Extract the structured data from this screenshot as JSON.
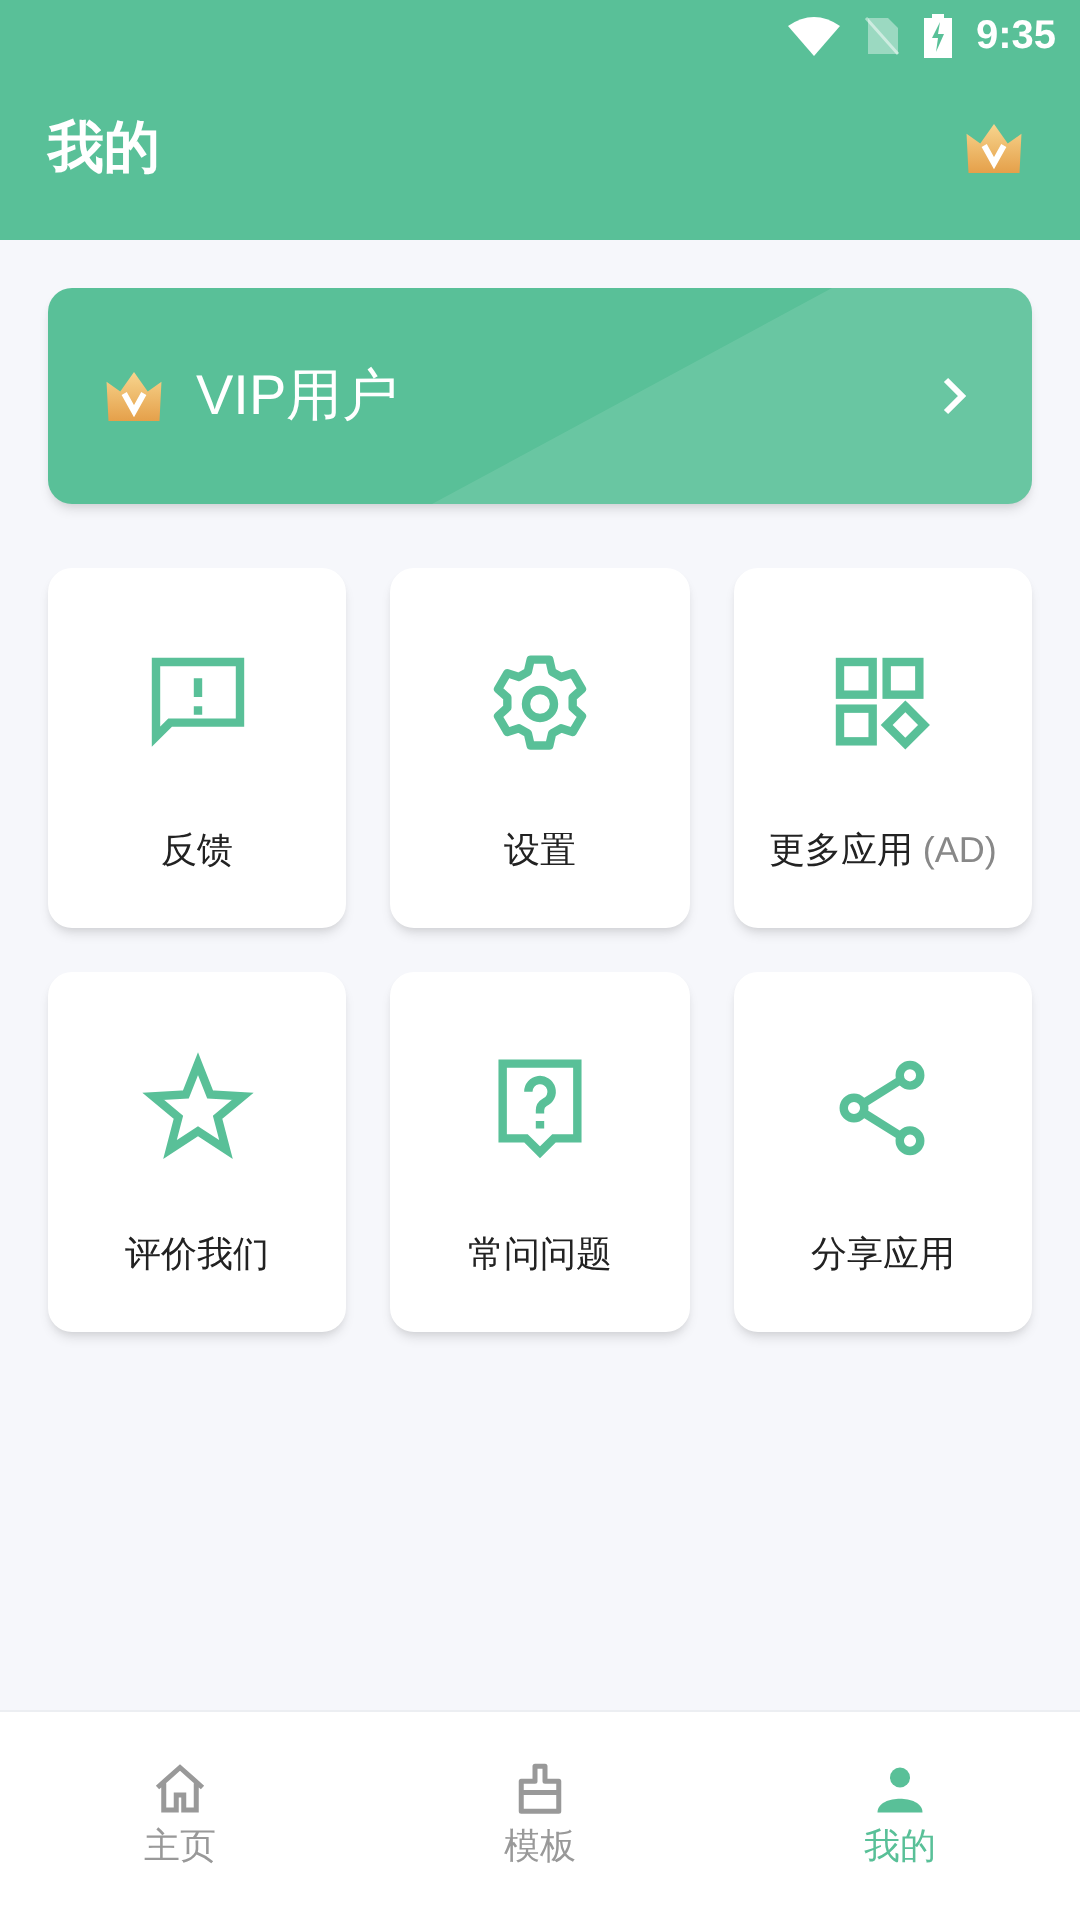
{
  "status_bar": {
    "time": "9:35"
  },
  "header": {
    "title": "我的"
  },
  "vip_card": {
    "label": "VIP用户"
  },
  "grid": [
    {
      "kind": "feedback",
      "label": "反馈"
    },
    {
      "kind": "settings",
      "label": "设置"
    },
    {
      "kind": "apps",
      "label": "更多应用",
      "tag": "(AD)"
    },
    {
      "kind": "star",
      "label": "评价我们"
    },
    {
      "kind": "faq",
      "label": "常问问题"
    },
    {
      "kind": "share",
      "label": "分享应用"
    }
  ],
  "bottom_nav": [
    {
      "kind": "home",
      "label": "主页",
      "selected": false
    },
    {
      "kind": "brush",
      "label": "模板",
      "selected": false
    },
    {
      "kind": "person",
      "label": "我的",
      "selected": true
    }
  ]
}
